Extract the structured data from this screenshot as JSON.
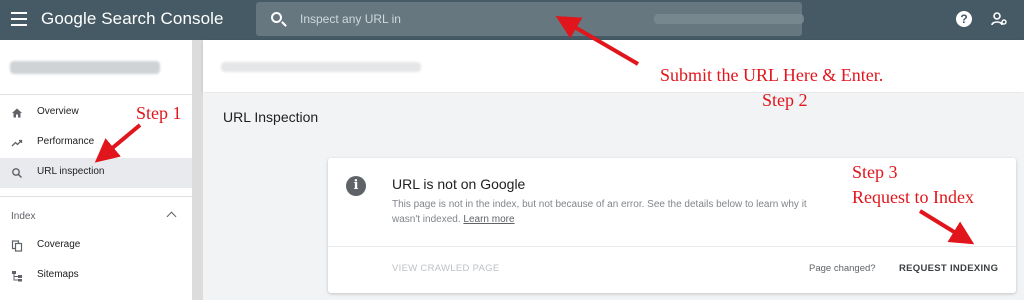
{
  "app": {
    "title": "Google Search Console"
  },
  "search": {
    "placeholder": "Inspect any URL in"
  },
  "sidebar": {
    "items": [
      {
        "label": "Overview",
        "icon": "home-icon"
      },
      {
        "label": "Performance",
        "icon": "trending-up-icon"
      },
      {
        "label": "URL inspection",
        "icon": "search-icon",
        "active": true
      }
    ],
    "section": "Index",
    "index_items": [
      {
        "label": "Coverage",
        "icon": "copy-icon"
      },
      {
        "label": "Sitemaps",
        "icon": "sitemap-icon"
      }
    ]
  },
  "main": {
    "title": "URL Inspection",
    "card": {
      "title": "URL is not on Google",
      "description": "This page is not in the index, but not because of an error. See the details below to learn why it wasn't indexed.",
      "learn_more": "Learn more",
      "view_crawled": "VIEW CRAWLED PAGE",
      "page_changed": "Page changed?",
      "request_indexing": "REQUEST INDEXING"
    }
  },
  "annotations": {
    "step1": "Step 1",
    "step2_line1": "Submit the URL Here & Enter.",
    "step2_line2": "Step 2",
    "step3_line1": "Step 3",
    "step3_line2": "Request to Index",
    "color": "#e0161c"
  }
}
